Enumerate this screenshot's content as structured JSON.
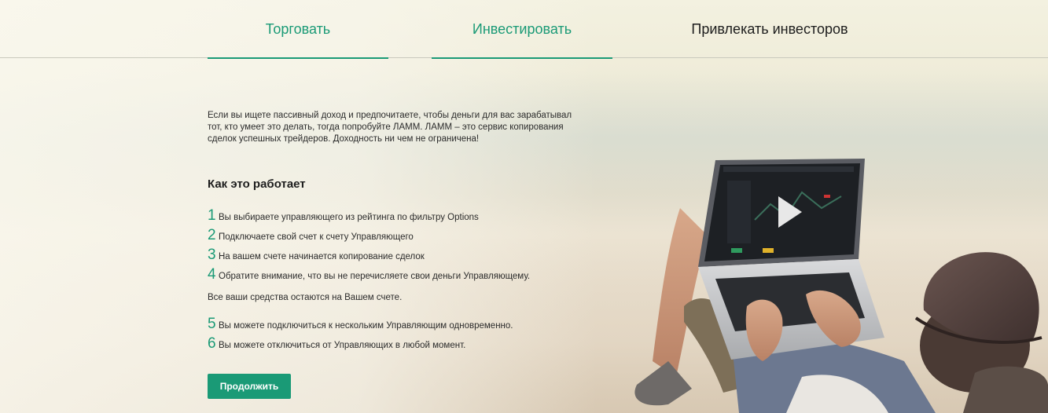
{
  "tabs": [
    {
      "label": "Торговать",
      "active": true
    },
    {
      "label": "Инвестировать",
      "active": true
    },
    {
      "label": "Привлекать инвесторов",
      "active": false
    }
  ],
  "intro": "Если вы ищете пассивный доход и предпочитаете, чтобы деньги для вас зарабатывал тот, кто умеет это делать, тогда попробуйте ЛАММ. ЛАММ – это сервис копирования сделок успешных трейдеров. Доходность ни чем не ограничена!",
  "how_it_works": {
    "title": "Как это работает",
    "steps_a": [
      {
        "num": "1",
        "text": "Вы выбираете управляющего из рейтинга по фильтру Options"
      },
      {
        "num": "2",
        "text": "Подключаете свой счет к счету Управляющего"
      },
      {
        "num": "3",
        "text": "На вашем счете начинается копирование сделок"
      },
      {
        "num": "4",
        "text": "Обратите внимание, что вы не перечисляете свои деньги Управляющему."
      }
    ],
    "note": "Все ваши средства остаются на Вашем счете.",
    "steps_b": [
      {
        "num": "5",
        "text": "Вы можете подключиться к нескольким Управляющим одновременно."
      },
      {
        "num": "6",
        "text": "Вы можете отключиться от Управляющих в любой момент."
      }
    ]
  },
  "continue_label": "Продолжить",
  "colors": {
    "accent": "#1a9a76",
    "text": "#2b2b2b"
  },
  "icons": {
    "video_play": "play-icon"
  }
}
